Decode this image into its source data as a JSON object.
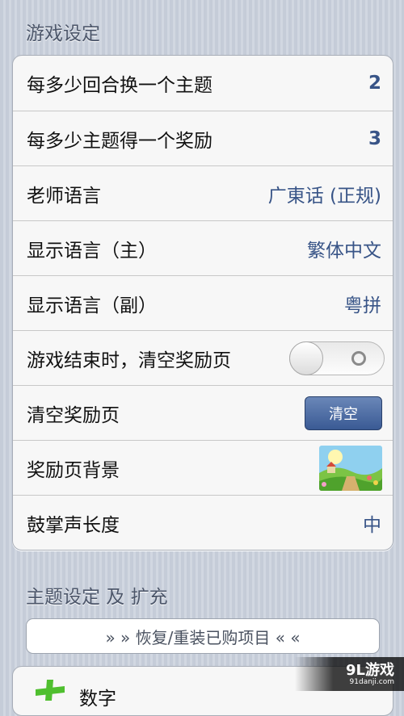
{
  "game_settings": {
    "title": "游戏设定",
    "rows": [
      {
        "label": "每多少回合换一个主题",
        "value": "2"
      },
      {
        "label": "每多少主题得一个奖励",
        "value": "3"
      },
      {
        "label": "老师语言",
        "value": "广東话 (正规)"
      },
      {
        "label": "显示语言（主）",
        "value": "繁体中文"
      },
      {
        "label": "显示语言（副）",
        "value": "粤拼"
      },
      {
        "label": "游戏结束时，清空奖励页",
        "toggle_on": false
      },
      {
        "label": "清空奖励页",
        "button": "清空"
      },
      {
        "label": "奖励页背景",
        "thumbnail": "landscape-thumbnail"
      },
      {
        "label": "鼓掌声长度",
        "value": "中"
      }
    ]
  },
  "topic_settings": {
    "title": "主题设定 及 扩充",
    "restore_button": "» » 恢复/重装已购项目 « «",
    "first_item_label": "数字"
  },
  "watermark": {
    "main": "9L游戏",
    "sub": "91danji.com"
  },
  "colors": {
    "background": "#cbd2dd",
    "value_text": "#385487",
    "button": "#3a5a94"
  }
}
